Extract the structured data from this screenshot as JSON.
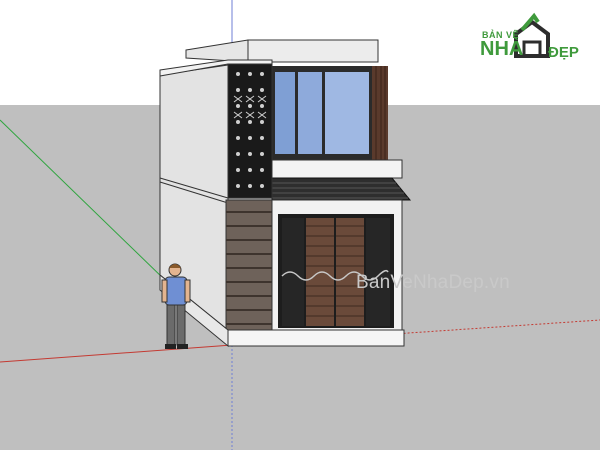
{
  "viewport": {
    "ground_color": "#bfbfbf",
    "sky_color": "#ffffff",
    "axis_colors": {
      "green": "#2fa53f",
      "red": "#c43a32",
      "blue": "#6f7fd6"
    }
  },
  "logo": {
    "top_text": "BẢN VẼ",
    "main_text": "NHÀ",
    "end_text": "ĐẸP",
    "brand_color": "#3f9a3c"
  },
  "watermark": {
    "text": "BanVeNhaDep.vn"
  }
}
